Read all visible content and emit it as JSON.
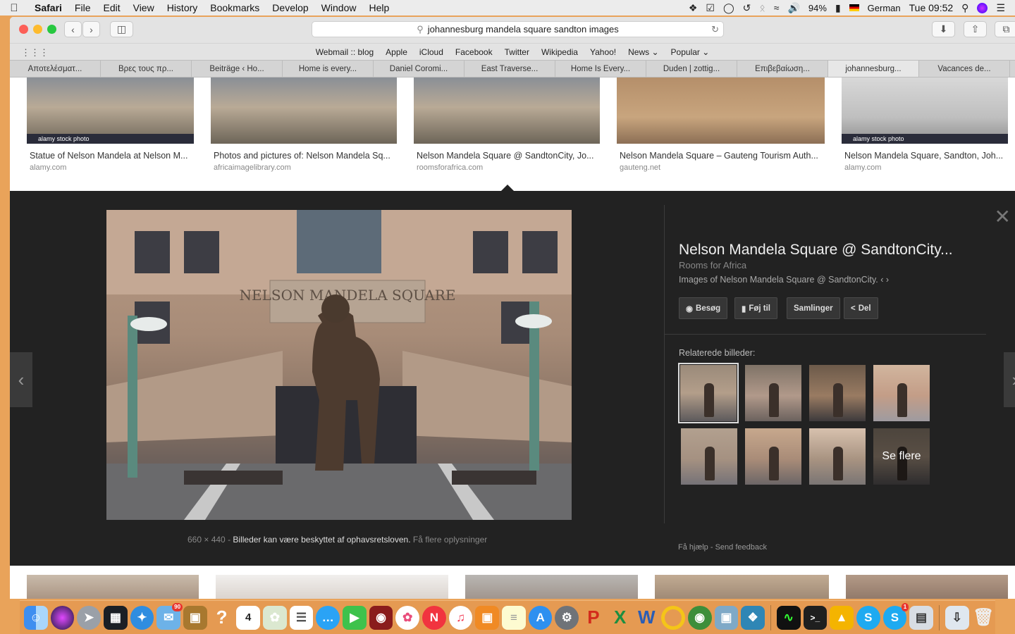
{
  "menubar": {
    "app": "Safari",
    "items": [
      "File",
      "Edit",
      "View",
      "History",
      "Bookmarks",
      "Develop",
      "Window",
      "Help"
    ],
    "battery": "94%",
    "input_language": "German",
    "clock": "Tue 09:52"
  },
  "toolbar": {
    "url": "johannesburg mandela square sandton images"
  },
  "favorites": [
    "Webmail :: blog",
    "Apple",
    "iCloud",
    "Facebook",
    "Twitter",
    "Wikipedia",
    "Yahoo!",
    "News ⌄",
    "Popular ⌄"
  ],
  "tabs": [
    {
      "label": "Αποτελέσματ..."
    },
    {
      "label": "Βρες τους πρ..."
    },
    {
      "label": "Beiträge ‹ Ho..."
    },
    {
      "label": "Home is every..."
    },
    {
      "label": "Daniel Coromi..."
    },
    {
      "label": "East Traverse..."
    },
    {
      "label": "Home Is Every..."
    },
    {
      "label": "Duden | zottig..."
    },
    {
      "label": "Επιβεβαίωση..."
    },
    {
      "label": "johannesburg..."
    },
    {
      "label": "Vacances de..."
    }
  ],
  "results_top": [
    {
      "caption": "Statue of Nelson Mandela at Nelson M...",
      "source": "alamy.com",
      "stripe": "alamy stock photo"
    },
    {
      "caption": "Photos and pictures of: Nelson Mandela Sq...",
      "source": "africaimagelibrary.com",
      "stripe": ""
    },
    {
      "caption": "Nelson Mandela Square @ SandtonCity, Jo...",
      "source": "roomsforafrica.com",
      "stripe": ""
    },
    {
      "caption": "Nelson Mandela Square – Gauteng Tourism Auth...",
      "source": "gauteng.net",
      "stripe": ""
    },
    {
      "caption": "Nelson Mandela Square, Sandton, Joh...",
      "source": "alamy.com",
      "stripe": "alamy stock photo"
    }
  ],
  "detail": {
    "title": "Nelson Mandela Square @ SandtonCity...",
    "site": "Rooms for Africa",
    "description": "Images of Nelson Mandela Square @ SandtonCity. ‹ ›",
    "buttons": {
      "visit": "Besøg",
      "save": "Føj til",
      "collections": "Samlinger",
      "share": "Del"
    },
    "related_label": "Relaterede billeder:",
    "see_more": "Se flere",
    "image_size": "660 × 440",
    "copyright": "Billeder kan være beskyttet af ophavsretsloven.",
    "more_info": "Få flere oplysninger",
    "help": "Få hjælp",
    "feedback": "Send feedback",
    "main_image_sign": "NELSON MANDELA SQUARE"
  },
  "dock": {
    "mail_badge": "90",
    "calendar_day": "4",
    "skype_badge": "1"
  }
}
